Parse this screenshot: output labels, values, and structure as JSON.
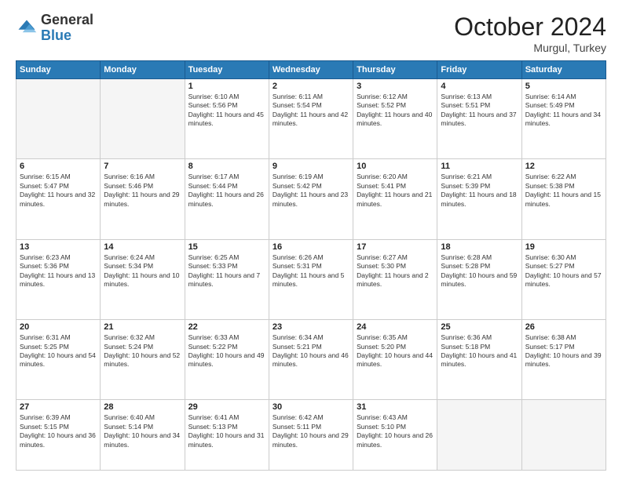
{
  "header": {
    "logo_general": "General",
    "logo_blue": "Blue",
    "month_title": "October 2024",
    "location": "Murgul, Turkey"
  },
  "weekdays": [
    "Sunday",
    "Monday",
    "Tuesday",
    "Wednesday",
    "Thursday",
    "Friday",
    "Saturday"
  ],
  "weeks": [
    [
      {
        "day": "",
        "info": ""
      },
      {
        "day": "",
        "info": ""
      },
      {
        "day": "1",
        "info": "Sunrise: 6:10 AM\nSunset: 5:56 PM\nDaylight: 11 hours and 45 minutes."
      },
      {
        "day": "2",
        "info": "Sunrise: 6:11 AM\nSunset: 5:54 PM\nDaylight: 11 hours and 42 minutes."
      },
      {
        "day": "3",
        "info": "Sunrise: 6:12 AM\nSunset: 5:52 PM\nDaylight: 11 hours and 40 minutes."
      },
      {
        "day": "4",
        "info": "Sunrise: 6:13 AM\nSunset: 5:51 PM\nDaylight: 11 hours and 37 minutes."
      },
      {
        "day": "5",
        "info": "Sunrise: 6:14 AM\nSunset: 5:49 PM\nDaylight: 11 hours and 34 minutes."
      }
    ],
    [
      {
        "day": "6",
        "info": "Sunrise: 6:15 AM\nSunset: 5:47 PM\nDaylight: 11 hours and 32 minutes."
      },
      {
        "day": "7",
        "info": "Sunrise: 6:16 AM\nSunset: 5:46 PM\nDaylight: 11 hours and 29 minutes."
      },
      {
        "day": "8",
        "info": "Sunrise: 6:17 AM\nSunset: 5:44 PM\nDaylight: 11 hours and 26 minutes."
      },
      {
        "day": "9",
        "info": "Sunrise: 6:19 AM\nSunset: 5:42 PM\nDaylight: 11 hours and 23 minutes."
      },
      {
        "day": "10",
        "info": "Sunrise: 6:20 AM\nSunset: 5:41 PM\nDaylight: 11 hours and 21 minutes."
      },
      {
        "day": "11",
        "info": "Sunrise: 6:21 AM\nSunset: 5:39 PM\nDaylight: 11 hours and 18 minutes."
      },
      {
        "day": "12",
        "info": "Sunrise: 6:22 AM\nSunset: 5:38 PM\nDaylight: 11 hours and 15 minutes."
      }
    ],
    [
      {
        "day": "13",
        "info": "Sunrise: 6:23 AM\nSunset: 5:36 PM\nDaylight: 11 hours and 13 minutes."
      },
      {
        "day": "14",
        "info": "Sunrise: 6:24 AM\nSunset: 5:34 PM\nDaylight: 11 hours and 10 minutes."
      },
      {
        "day": "15",
        "info": "Sunrise: 6:25 AM\nSunset: 5:33 PM\nDaylight: 11 hours and 7 minutes."
      },
      {
        "day": "16",
        "info": "Sunrise: 6:26 AM\nSunset: 5:31 PM\nDaylight: 11 hours and 5 minutes."
      },
      {
        "day": "17",
        "info": "Sunrise: 6:27 AM\nSunset: 5:30 PM\nDaylight: 11 hours and 2 minutes."
      },
      {
        "day": "18",
        "info": "Sunrise: 6:28 AM\nSunset: 5:28 PM\nDaylight: 10 hours and 59 minutes."
      },
      {
        "day": "19",
        "info": "Sunrise: 6:30 AM\nSunset: 5:27 PM\nDaylight: 10 hours and 57 minutes."
      }
    ],
    [
      {
        "day": "20",
        "info": "Sunrise: 6:31 AM\nSunset: 5:25 PM\nDaylight: 10 hours and 54 minutes."
      },
      {
        "day": "21",
        "info": "Sunrise: 6:32 AM\nSunset: 5:24 PM\nDaylight: 10 hours and 52 minutes."
      },
      {
        "day": "22",
        "info": "Sunrise: 6:33 AM\nSunset: 5:22 PM\nDaylight: 10 hours and 49 minutes."
      },
      {
        "day": "23",
        "info": "Sunrise: 6:34 AM\nSunset: 5:21 PM\nDaylight: 10 hours and 46 minutes."
      },
      {
        "day": "24",
        "info": "Sunrise: 6:35 AM\nSunset: 5:20 PM\nDaylight: 10 hours and 44 minutes."
      },
      {
        "day": "25",
        "info": "Sunrise: 6:36 AM\nSunset: 5:18 PM\nDaylight: 10 hours and 41 minutes."
      },
      {
        "day": "26",
        "info": "Sunrise: 6:38 AM\nSunset: 5:17 PM\nDaylight: 10 hours and 39 minutes."
      }
    ],
    [
      {
        "day": "27",
        "info": "Sunrise: 6:39 AM\nSunset: 5:15 PM\nDaylight: 10 hours and 36 minutes."
      },
      {
        "day": "28",
        "info": "Sunrise: 6:40 AM\nSunset: 5:14 PM\nDaylight: 10 hours and 34 minutes."
      },
      {
        "day": "29",
        "info": "Sunrise: 6:41 AM\nSunset: 5:13 PM\nDaylight: 10 hours and 31 minutes."
      },
      {
        "day": "30",
        "info": "Sunrise: 6:42 AM\nSunset: 5:11 PM\nDaylight: 10 hours and 29 minutes."
      },
      {
        "day": "31",
        "info": "Sunrise: 6:43 AM\nSunset: 5:10 PM\nDaylight: 10 hours and 26 minutes."
      },
      {
        "day": "",
        "info": ""
      },
      {
        "day": "",
        "info": ""
      }
    ]
  ]
}
